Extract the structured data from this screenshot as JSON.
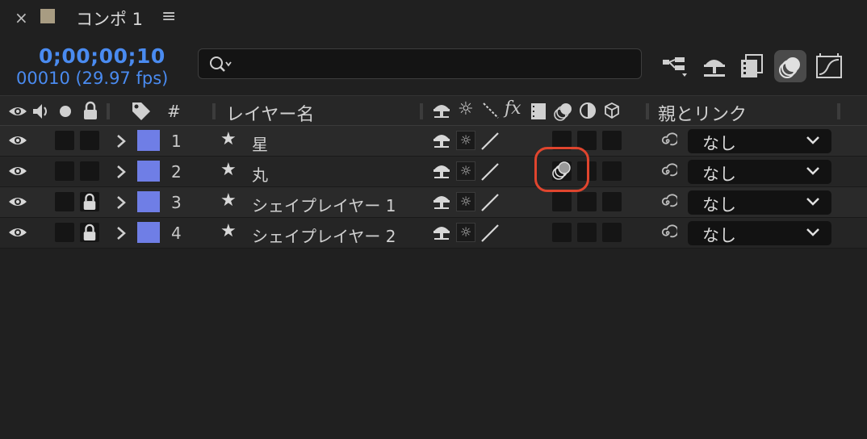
{
  "tab": {
    "close_label": "×",
    "title": "コンポ 1",
    "menu_icon": "hamburger-icon"
  },
  "timecode": {
    "current": "0;00;00;10",
    "frames": "00010 (29.97 fps)"
  },
  "search": {
    "placeholder": ""
  },
  "toolbar_icons": [
    "composition-mini-flowchart-icon",
    "draft-3d-icon",
    "frame-blending-icon",
    "motion-blur-icon",
    "graph-editor-icon"
  ],
  "columns": {
    "number": "#",
    "layer_name": "レイヤー名",
    "parent": "親とリンク"
  },
  "layers": [
    {
      "number": "1",
      "name": "星",
      "locked": false,
      "parent": "なし",
      "motion_blur_on": false
    },
    {
      "number": "2",
      "name": "丸",
      "locked": false,
      "parent": "なし",
      "motion_blur_on": true
    },
    {
      "number": "3",
      "name": "シェイプレイヤー 1",
      "locked": true,
      "parent": "なし",
      "motion_blur_on": false
    },
    {
      "number": "4",
      "name": "シェイプレイヤー 2",
      "locked": true,
      "parent": "なし",
      "motion_blur_on": false
    }
  ],
  "colors": {
    "accent": "#4a8bf0",
    "label": "#6f7ee6",
    "highlight": "#e0452e"
  }
}
